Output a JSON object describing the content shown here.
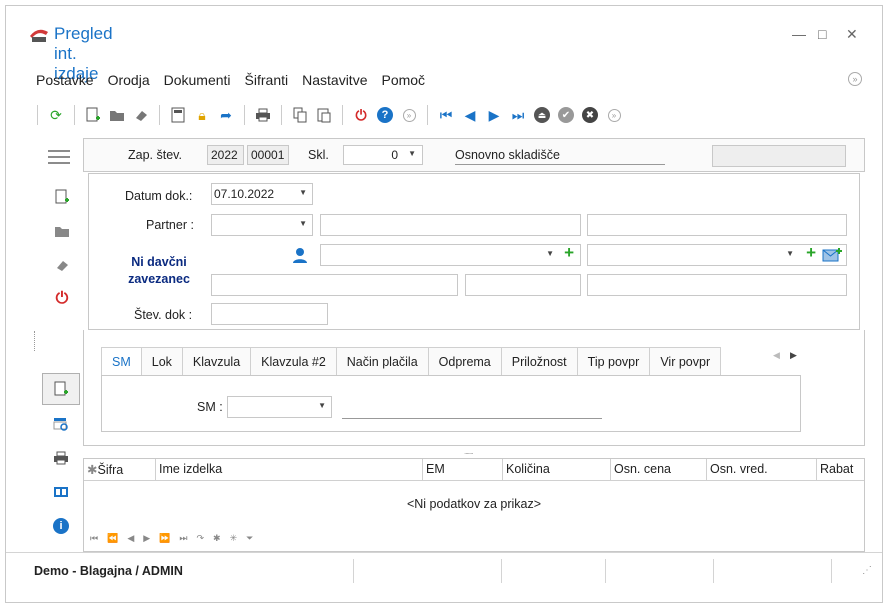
{
  "window": {
    "title": "Pregled int. izdaje",
    "minimize": "—",
    "maximize": "□",
    "close": "✕"
  },
  "menu": [
    "Postavke",
    "Orodja",
    "Dokumenti",
    "Šifranti",
    "Nastavitve",
    "Pomoč"
  ],
  "header": {
    "zap_label": "Zap. štev.",
    "zap_year": "2022",
    "zap_num": "00001",
    "skl_label": "Skl.",
    "skl_value": "0",
    "skl_name": "Osnovno skladišče"
  },
  "form": {
    "datum_label": "Datum dok.:",
    "datum_value": "07.10.2022",
    "partner_label": "Partner :",
    "davcni": "Ni davčni zavezanec",
    "stev_label": "Štev. dok :"
  },
  "tabs": [
    "SM",
    "Lok",
    "Klavzula",
    "Klavzula #2",
    "Način plačila",
    "Odprema",
    "Priložnost",
    "Tip povpr",
    "Vir povpr"
  ],
  "sm_label": "SM :",
  "grid": {
    "columns": [
      "Šifra",
      "Ime izdelka",
      "EM",
      "Količina",
      "Osn. cena",
      "Osn. vred.",
      "Rabat"
    ],
    "empty_text": "<Ni podatkov za prikaz>"
  },
  "status": {
    "text": "Demo - Blagajna / ADMIN"
  },
  "colors": {
    "accent": "#1a73c7",
    "green": "#2aa52a",
    "red": "#d42a2a"
  }
}
